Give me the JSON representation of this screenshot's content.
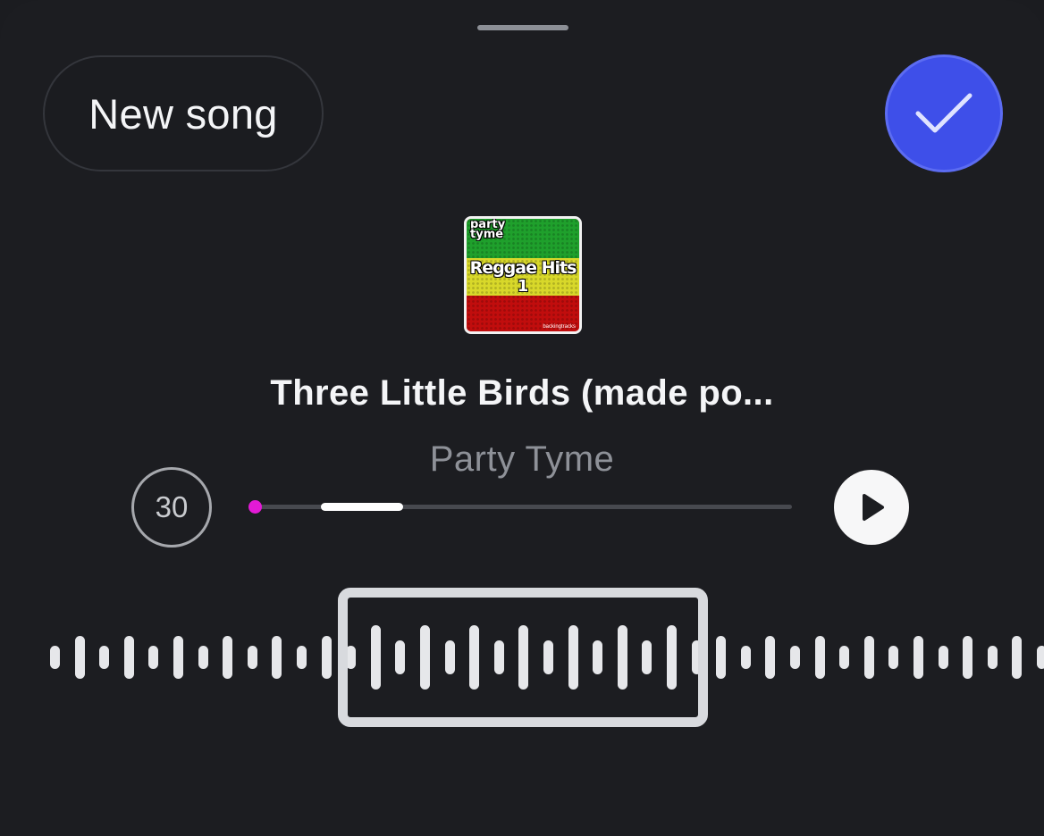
{
  "header": {
    "new_song_label": "New song",
    "confirm_icon": "checkmark-icon"
  },
  "album": {
    "brand": "party\ntyme",
    "art_title": "Reggae Hits",
    "art_number": "1",
    "art_footer": "backingtracks"
  },
  "song": {
    "title": "Three Little Birds (made po...",
    "artist": "Party Tyme"
  },
  "player": {
    "clip_duration": "30",
    "playhead_fraction": 0.0,
    "clip_segment_start_fraction": 0.133,
    "clip_segment_end_fraction": 0.285,
    "play_icon": "play-icon"
  },
  "waveform": {
    "pattern": [
      "short",
      "tall"
    ],
    "selection_icon": "selection-window"
  },
  "colors": {
    "accent": "#3e4fe9",
    "playhead": "#e31ad6",
    "background": "#1c1d21"
  }
}
